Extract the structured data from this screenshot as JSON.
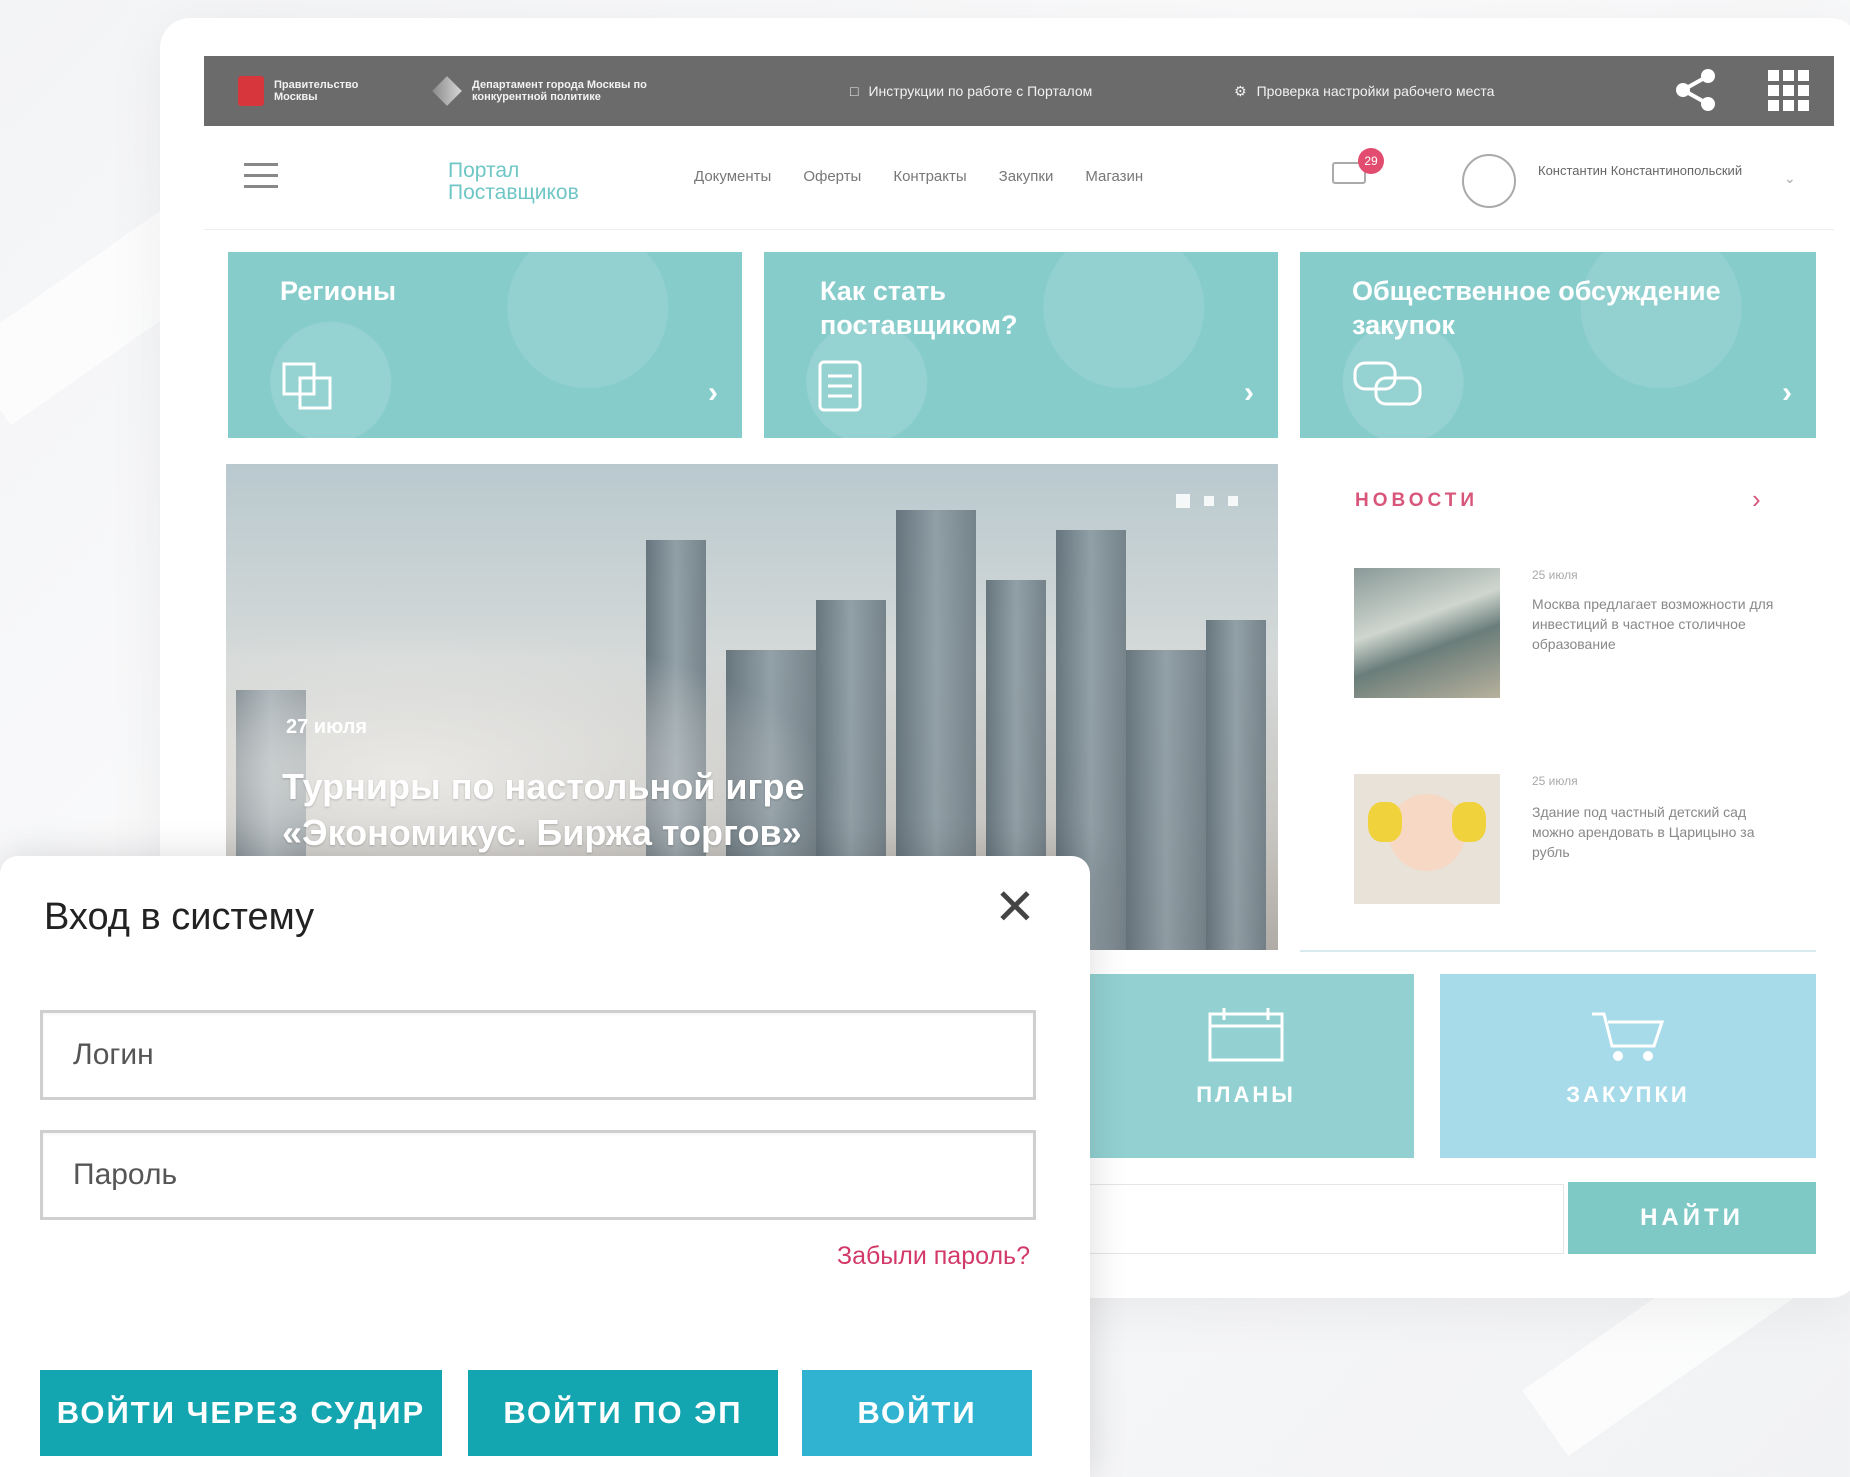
{
  "topbar": {
    "gov_label": "Правительство Москвы",
    "dep_label": "Департамент города Москвы по конкурентной политике",
    "instructions_label": "Инструкции по работе с Порталом",
    "check_label": "Проверка настройки рабочего места"
  },
  "header": {
    "logo": "Портал Поставщиков",
    "nav": [
      "Документы",
      "Оферты",
      "Контракты",
      "Закупки",
      "Магазин"
    ],
    "mail_count": "29",
    "user_name": "Константин Константинопольский"
  },
  "tiles": [
    {
      "title": "Регионы"
    },
    {
      "title": "Как стать поставщиком?"
    },
    {
      "title": "Общественное обсуждение закупок"
    }
  ],
  "hero": {
    "date": "27 июля",
    "title": "Турниры по настольной игре «Экономикус. Биржа торгов»"
  },
  "news": {
    "heading": "НОВОСТИ",
    "items": [
      {
        "date": "25 июля",
        "text": "Москва предлагает возможности для инвестиций в частное столичное образование"
      },
      {
        "date": "25 июля",
        "text": "Здание под частный детский сад можно арендовать в Царицыно за рубль"
      }
    ]
  },
  "lower_tiles": {
    "plans": "ПЛАНЫ",
    "purchases": "ЗАКУПКИ"
  },
  "search": {
    "button": "НАЙТИ"
  },
  "login": {
    "title": "Вход в систему",
    "login_placeholder": "Логин",
    "password_placeholder": "Пароль",
    "forgot": "Забыли пароль?",
    "btn_sudir": "ВОЙТИ ЧЕРЕЗ СУДИР",
    "btn_ep": "ВОЙТИ ПО ЭП",
    "btn_enter": "ВОЙТИ"
  },
  "colors": {
    "accent_teal": "#14a6b0",
    "accent_blue": "#2fb3d0",
    "link_pink": "#d23968",
    "tile_teal": "#86cccb"
  }
}
